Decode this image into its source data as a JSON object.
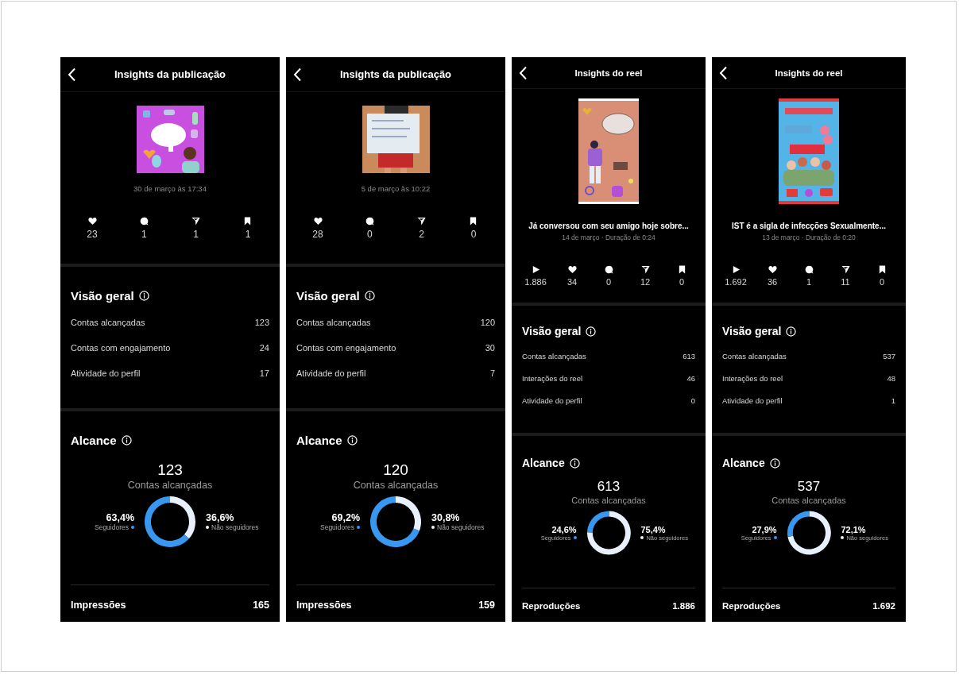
{
  "phones": [
    {
      "kind": "post",
      "title": "Insights da publicação",
      "date": "30 de março às 17:34",
      "stats": [
        {
          "kind": "likes",
          "value": "23"
        },
        {
          "kind": "comments",
          "value": "1"
        },
        {
          "kind": "shares",
          "value": "1"
        },
        {
          "kind": "saves",
          "value": "1"
        }
      ],
      "overview": {
        "title": "Visão geral",
        "rows": [
          {
            "label": "Contas alcançadas",
            "value": "123"
          },
          {
            "label": "Contas com engajamento",
            "value": "24"
          },
          {
            "label": "Atividade do perfil",
            "value": "17"
          }
        ]
      },
      "reach": {
        "title": "Alcance",
        "total": "123",
        "chart_data": {
          "type": "donut",
          "categories": [
            "Seguidores",
            "Não seguidores"
          ],
          "series": [
            {
              "name": "Contas alcançadas",
              "values": [
                63.4,
                36.6
              ]
            }
          ]
        },
        "legend": [
          {
            "percent": "63,4%",
            "color": "#3897f0"
          },
          {
            "percent": "36,6%",
            "color": "#e8f1fb"
          }
        ]
      },
      "footer": {
        "label": "Impressões",
        "value": "165"
      }
    },
    {
      "kind": "post",
      "title": "Insights da publicação",
      "date": "5 de março às 10:22",
      "stats": [
        {
          "kind": "likes",
          "value": "28"
        },
        {
          "kind": "comments",
          "value": "0"
        },
        {
          "kind": "shares",
          "value": "2"
        },
        {
          "kind": "saves",
          "value": "0"
        }
      ],
      "overview": {
        "title": "Visão geral",
        "rows": [
          {
            "label": "Contas alcançadas",
            "value": "120"
          },
          {
            "label": "Contas com engajamento",
            "value": "30"
          },
          {
            "label": "Atividade do perfil",
            "value": "7"
          }
        ]
      },
      "reach": {
        "title": "Alcance",
        "total": "120",
        "chart_data": {
          "type": "donut",
          "categories": [
            "Seguidores",
            "Não seguidores"
          ],
          "series": [
            {
              "name": "Contas alcançadas",
              "values": [
                69.2,
                30.8
              ]
            }
          ]
        },
        "legend": [
          {
            "percent": "69,2%",
            "color": "#3897f0"
          },
          {
            "percent": "30,8%",
            "color": "#e8f1fb"
          }
        ]
      },
      "footer": {
        "label": "Impressões",
        "value": "159"
      }
    },
    {
      "kind": "reel",
      "title": "Insights do reel",
      "caption": "Já conversou com seu amigo hoje sobre...",
      "date": "14 de março · Duração de 0:24",
      "stats": [
        {
          "kind": "plays",
          "value": "1.886"
        },
        {
          "kind": "likes",
          "value": "34"
        },
        {
          "kind": "comments",
          "value": "0"
        },
        {
          "kind": "shares",
          "value": "12"
        },
        {
          "kind": "saves",
          "value": "0"
        }
      ],
      "overview": {
        "title": "Visão geral",
        "rows": [
          {
            "label": "Contas alcançadas",
            "value": "613"
          },
          {
            "label": "Interações do reel",
            "value": "46"
          },
          {
            "label": "Atividade do perfil",
            "value": "0"
          }
        ]
      },
      "reach": {
        "title": "Alcance",
        "total": "613",
        "chart_data": {
          "type": "donut",
          "categories": [
            "Seguidores",
            "Não seguidores"
          ],
          "series": [
            {
              "name": "Contas alcançadas",
              "values": [
                24.6,
                75.4
              ]
            }
          ]
        },
        "legend": [
          {
            "percent": "24,6%",
            "color": "#3897f0"
          },
          {
            "percent": "75,4%",
            "color": "#e8f1fb"
          }
        ]
      },
      "footer": {
        "label": "Reproduções",
        "value": "1.886"
      }
    },
    {
      "kind": "reel",
      "title": "Insights do reel",
      "caption": "IST é a sigla de infecções Sexualmente...",
      "date": "13 de março · Duração de 0:20",
      "stats": [
        {
          "kind": "plays",
          "value": "1.692"
        },
        {
          "kind": "likes",
          "value": "36"
        },
        {
          "kind": "comments",
          "value": "1"
        },
        {
          "kind": "shares",
          "value": "11"
        },
        {
          "kind": "saves",
          "value": "0"
        }
      ],
      "overview": {
        "title": "Visão geral",
        "rows": [
          {
            "label": "Contas alcançadas",
            "value": "537"
          },
          {
            "label": "Interações do reel",
            "value": "48"
          },
          {
            "label": "Atividade do perfil",
            "value": "1"
          }
        ]
      },
      "reach": {
        "title": "Alcance",
        "total": "537",
        "chart_data": {
          "type": "donut",
          "categories": [
            "Seguidores",
            "Não seguidores"
          ],
          "series": [
            {
              "name": "Contas alcançadas",
              "values": [
                27.9,
                72.1
              ]
            }
          ]
        },
        "legend": [
          {
            "percent": "27,9%",
            "color": "#3897f0"
          },
          {
            "percent": "72,1%",
            "color": "#e8f1fb"
          }
        ]
      },
      "footer": {
        "label": "Reproduções",
        "value": "1.692"
      }
    }
  ]
}
